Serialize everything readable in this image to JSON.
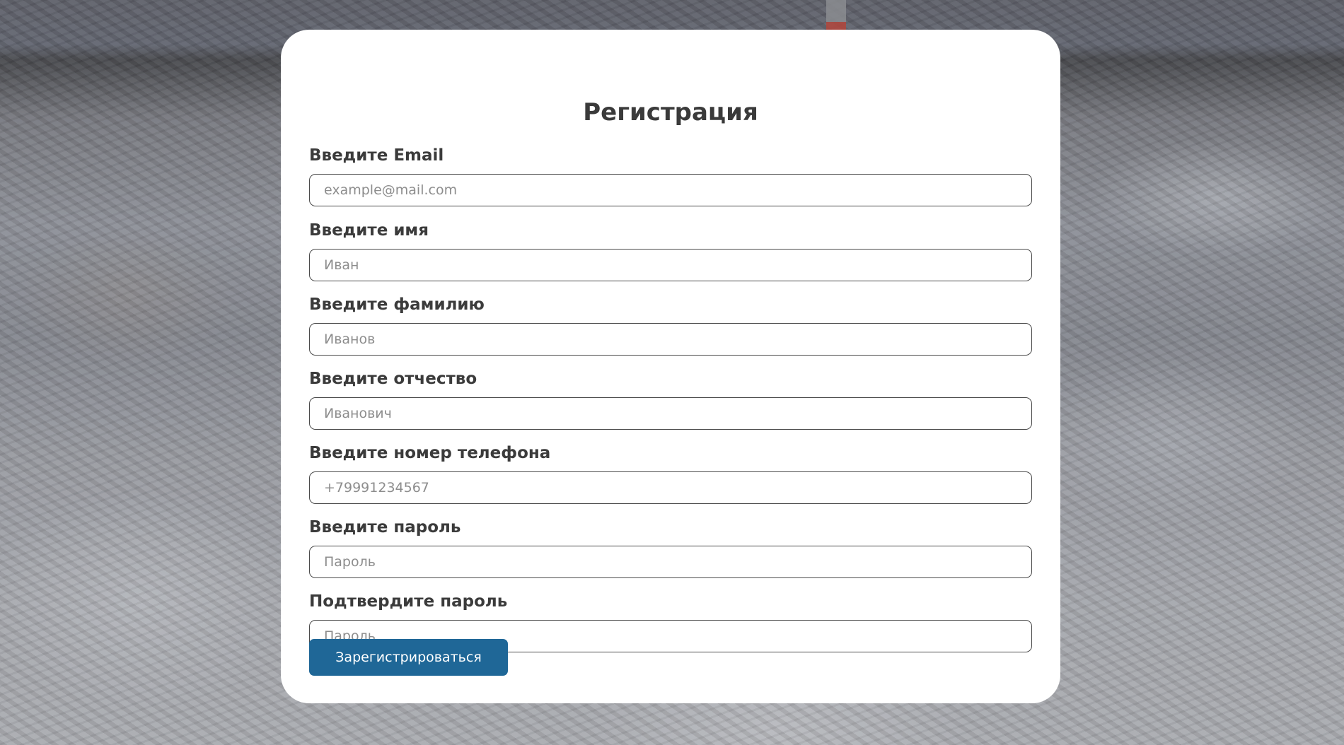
{
  "page": {
    "title": "Регистрация",
    "background": "snowy-aerial-town-photo"
  },
  "form": {
    "fields": [
      {
        "label": "Введите Email",
        "placeholder": "example@mail.com",
        "type": "email"
      },
      {
        "label": "Введите имя",
        "placeholder": "Иван",
        "type": "text"
      },
      {
        "label": "Введите фамилию",
        "placeholder": "Иванов",
        "type": "text"
      },
      {
        "label": "Введите отчество",
        "placeholder": "Иванович",
        "type": "text"
      },
      {
        "label": "Введите номер телефона",
        "placeholder": "+79991234567",
        "type": "tel"
      },
      {
        "label": "Введите пароль",
        "placeholder": "Пароль",
        "type": "password"
      },
      {
        "label": "Подтвердите пароль",
        "placeholder": "Пароль",
        "type": "password"
      }
    ],
    "submit_label": "Зарегистрироваться"
  },
  "colors": {
    "accent": "#1f6797",
    "card": "#ffffff",
    "text": "#3b3b3b",
    "placeholder": "#8d8d8d"
  }
}
